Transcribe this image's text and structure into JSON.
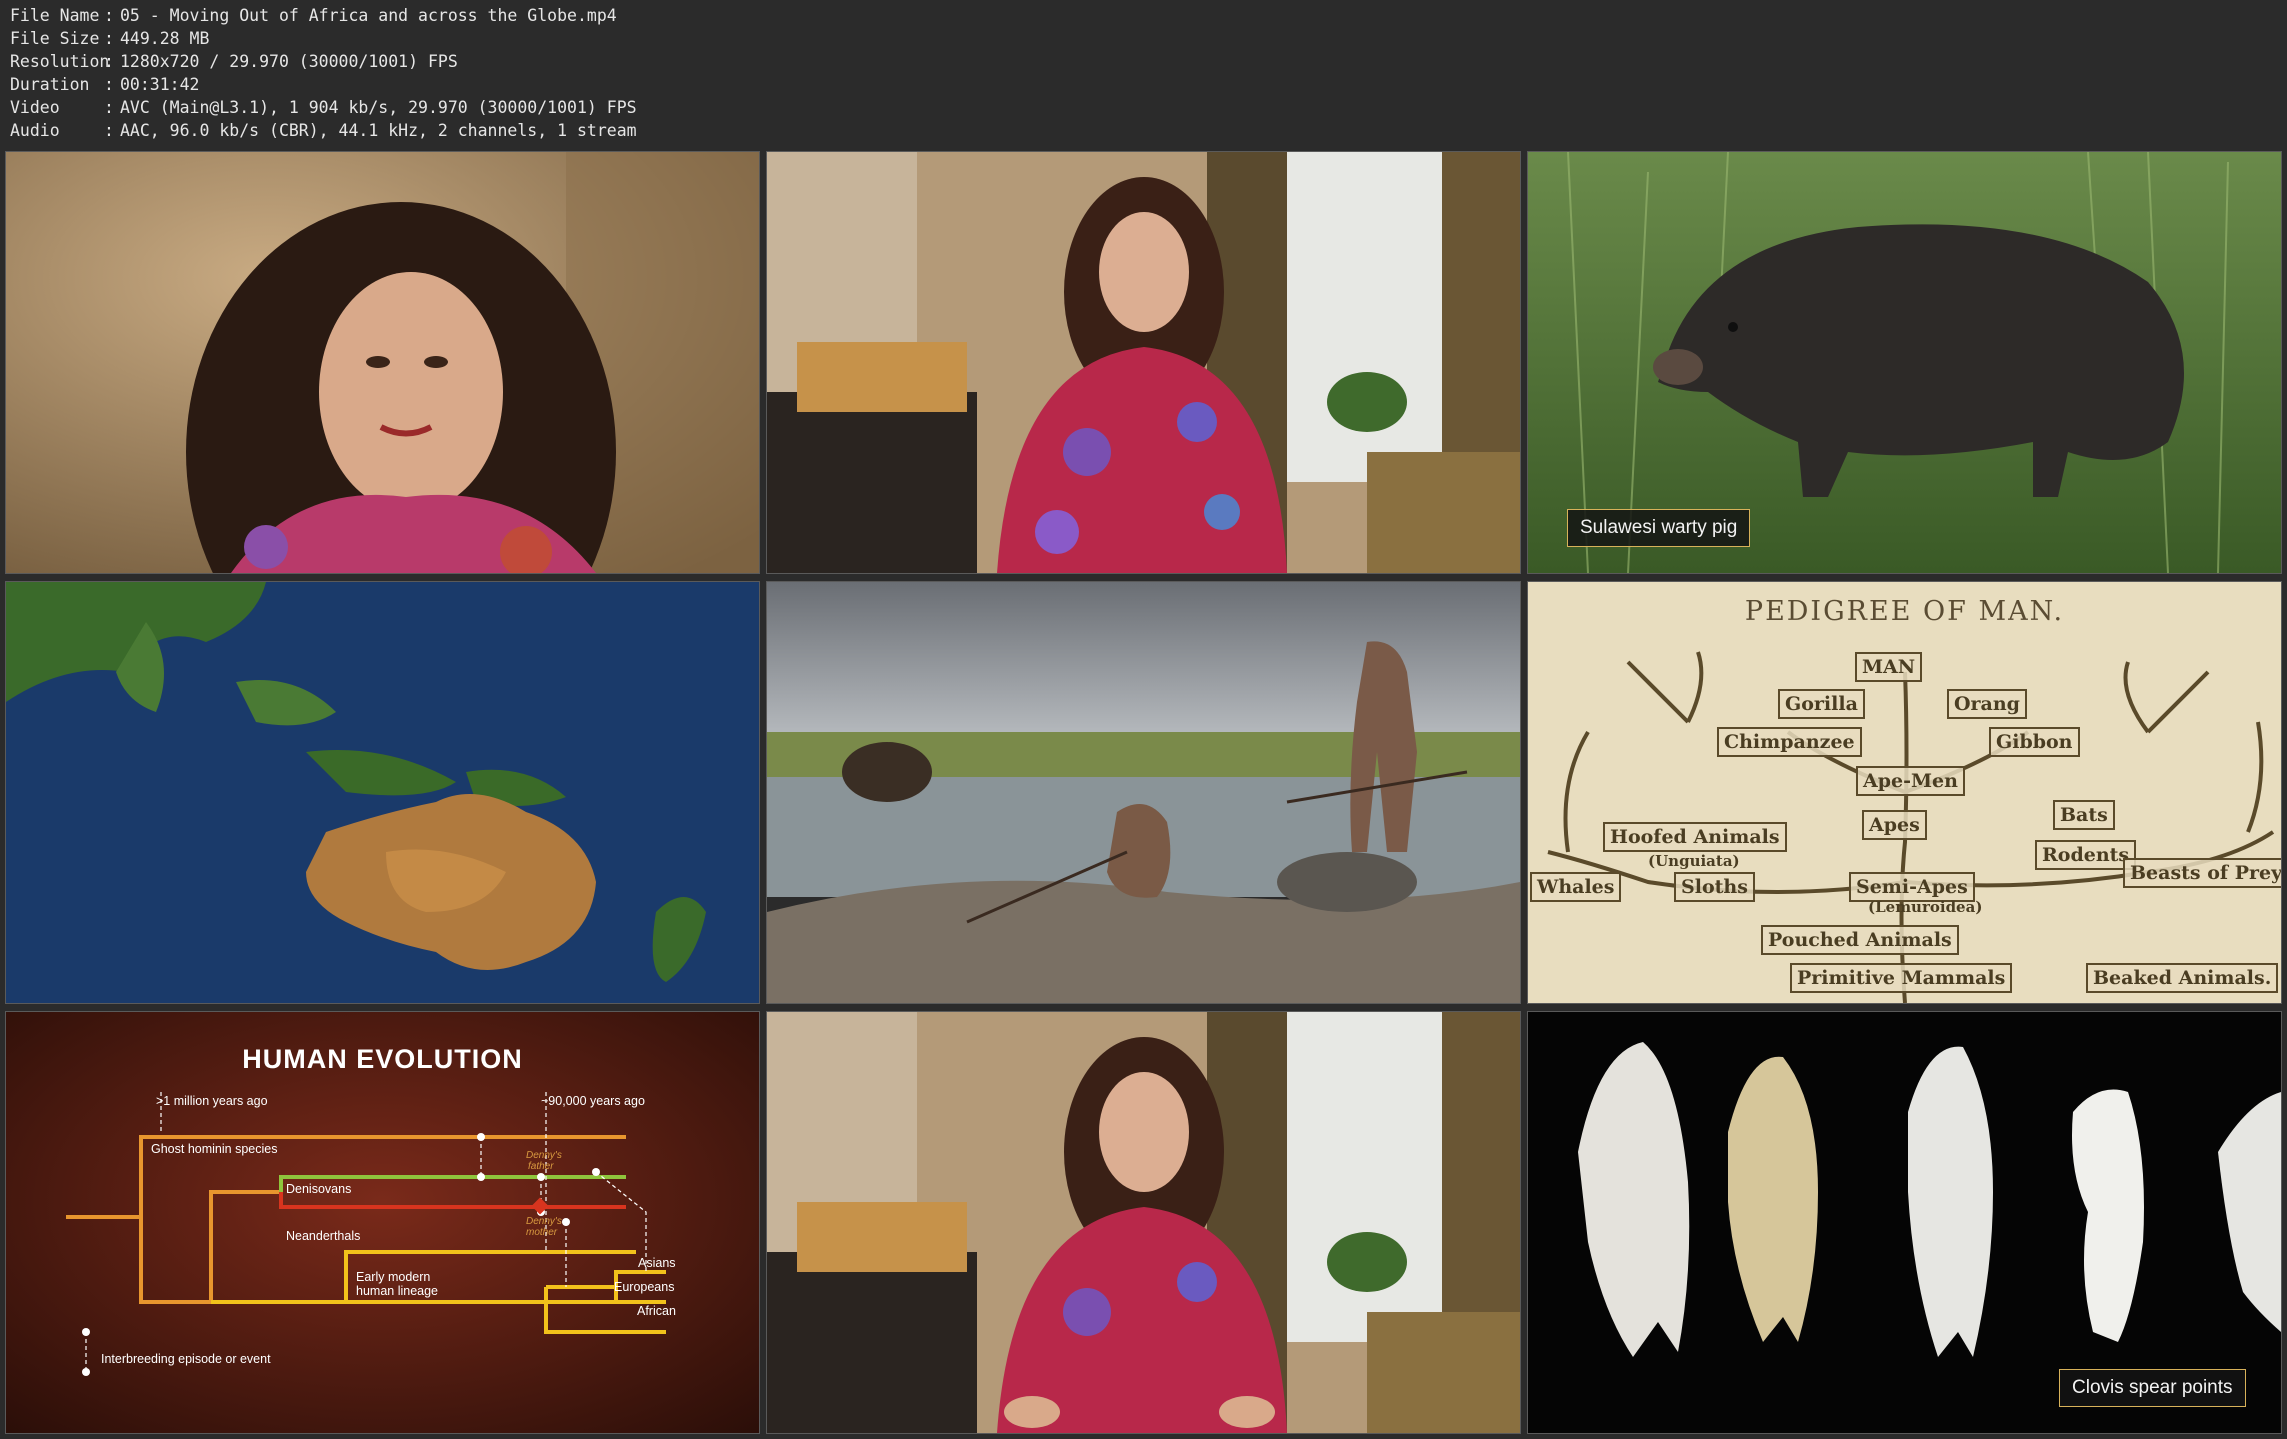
{
  "info": {
    "rows": [
      {
        "key": "File Name",
        "value": "05 - Moving Out of Africa and across the Globe.mp4"
      },
      {
        "key": "File Size",
        "value": "449.28 MB"
      },
      {
        "key": "Resolution",
        "value": "1280x720 / 29.970 (30000/1001) FPS"
      },
      {
        "key": "Duration",
        "value": "00:31:42"
      },
      {
        "key": "Video",
        "value": "AVC (Main@L3.1), 1 904 kb/s, 29.970 (30000/1001) FPS"
      },
      {
        "key": "Audio",
        "value": "AAC, 96.0 kb/s (CBR), 44.1 kHz, 2 channels, 1 stream"
      }
    ],
    "separator": ":"
  },
  "thumbnails": {
    "pig_caption": "Sulawesi warty pig",
    "clovis_caption": "Clovis spear points",
    "pedigree": {
      "title": "PEDIGREE OF MAN.",
      "labels": [
        "MAN",
        "Gorilla",
        "Orang",
        "Chimpanzee",
        "Gibbon",
        "Ape-Men",
        "Bats",
        "Hoofed Animals",
        "(Unguiata)",
        "Apes",
        "Rodents",
        "Whales",
        "Sloths",
        "Semi-Apes",
        "(Lemuroidea)",
        "Beasts of Prey",
        "Pouched Animals",
        "Primitive Mammals",
        "Beaked Animals."
      ]
    },
    "evolution": {
      "title": "HUMAN EVOLUTION",
      "million": ">1 million years ago",
      "ninety": "~90,000 years ago",
      "ghost": "Ghost hominin species",
      "denisovans": "Denisovans",
      "neanderthals": "Neanderthals",
      "early_modern_1": "Early modern",
      "early_modern_2": "human lineage",
      "asians": "Asians",
      "europeans": "Europeans",
      "african": "African",
      "legend": "Interbreeding episode or event",
      "denny_father_1": "Denny's",
      "denny_father_2": "father",
      "denny_mother_1": "Denny's",
      "denny_mother_2": "mother"
    }
  },
  "colors": {
    "background": "#2b2b2b",
    "info_text": "#e6e6e6",
    "caption_border": "#d8b25a",
    "evo_orange": "#e8962e",
    "evo_yellow": "#f2c21b",
    "evo_green": "#8fc43c",
    "evo_red": "#d8341e"
  }
}
